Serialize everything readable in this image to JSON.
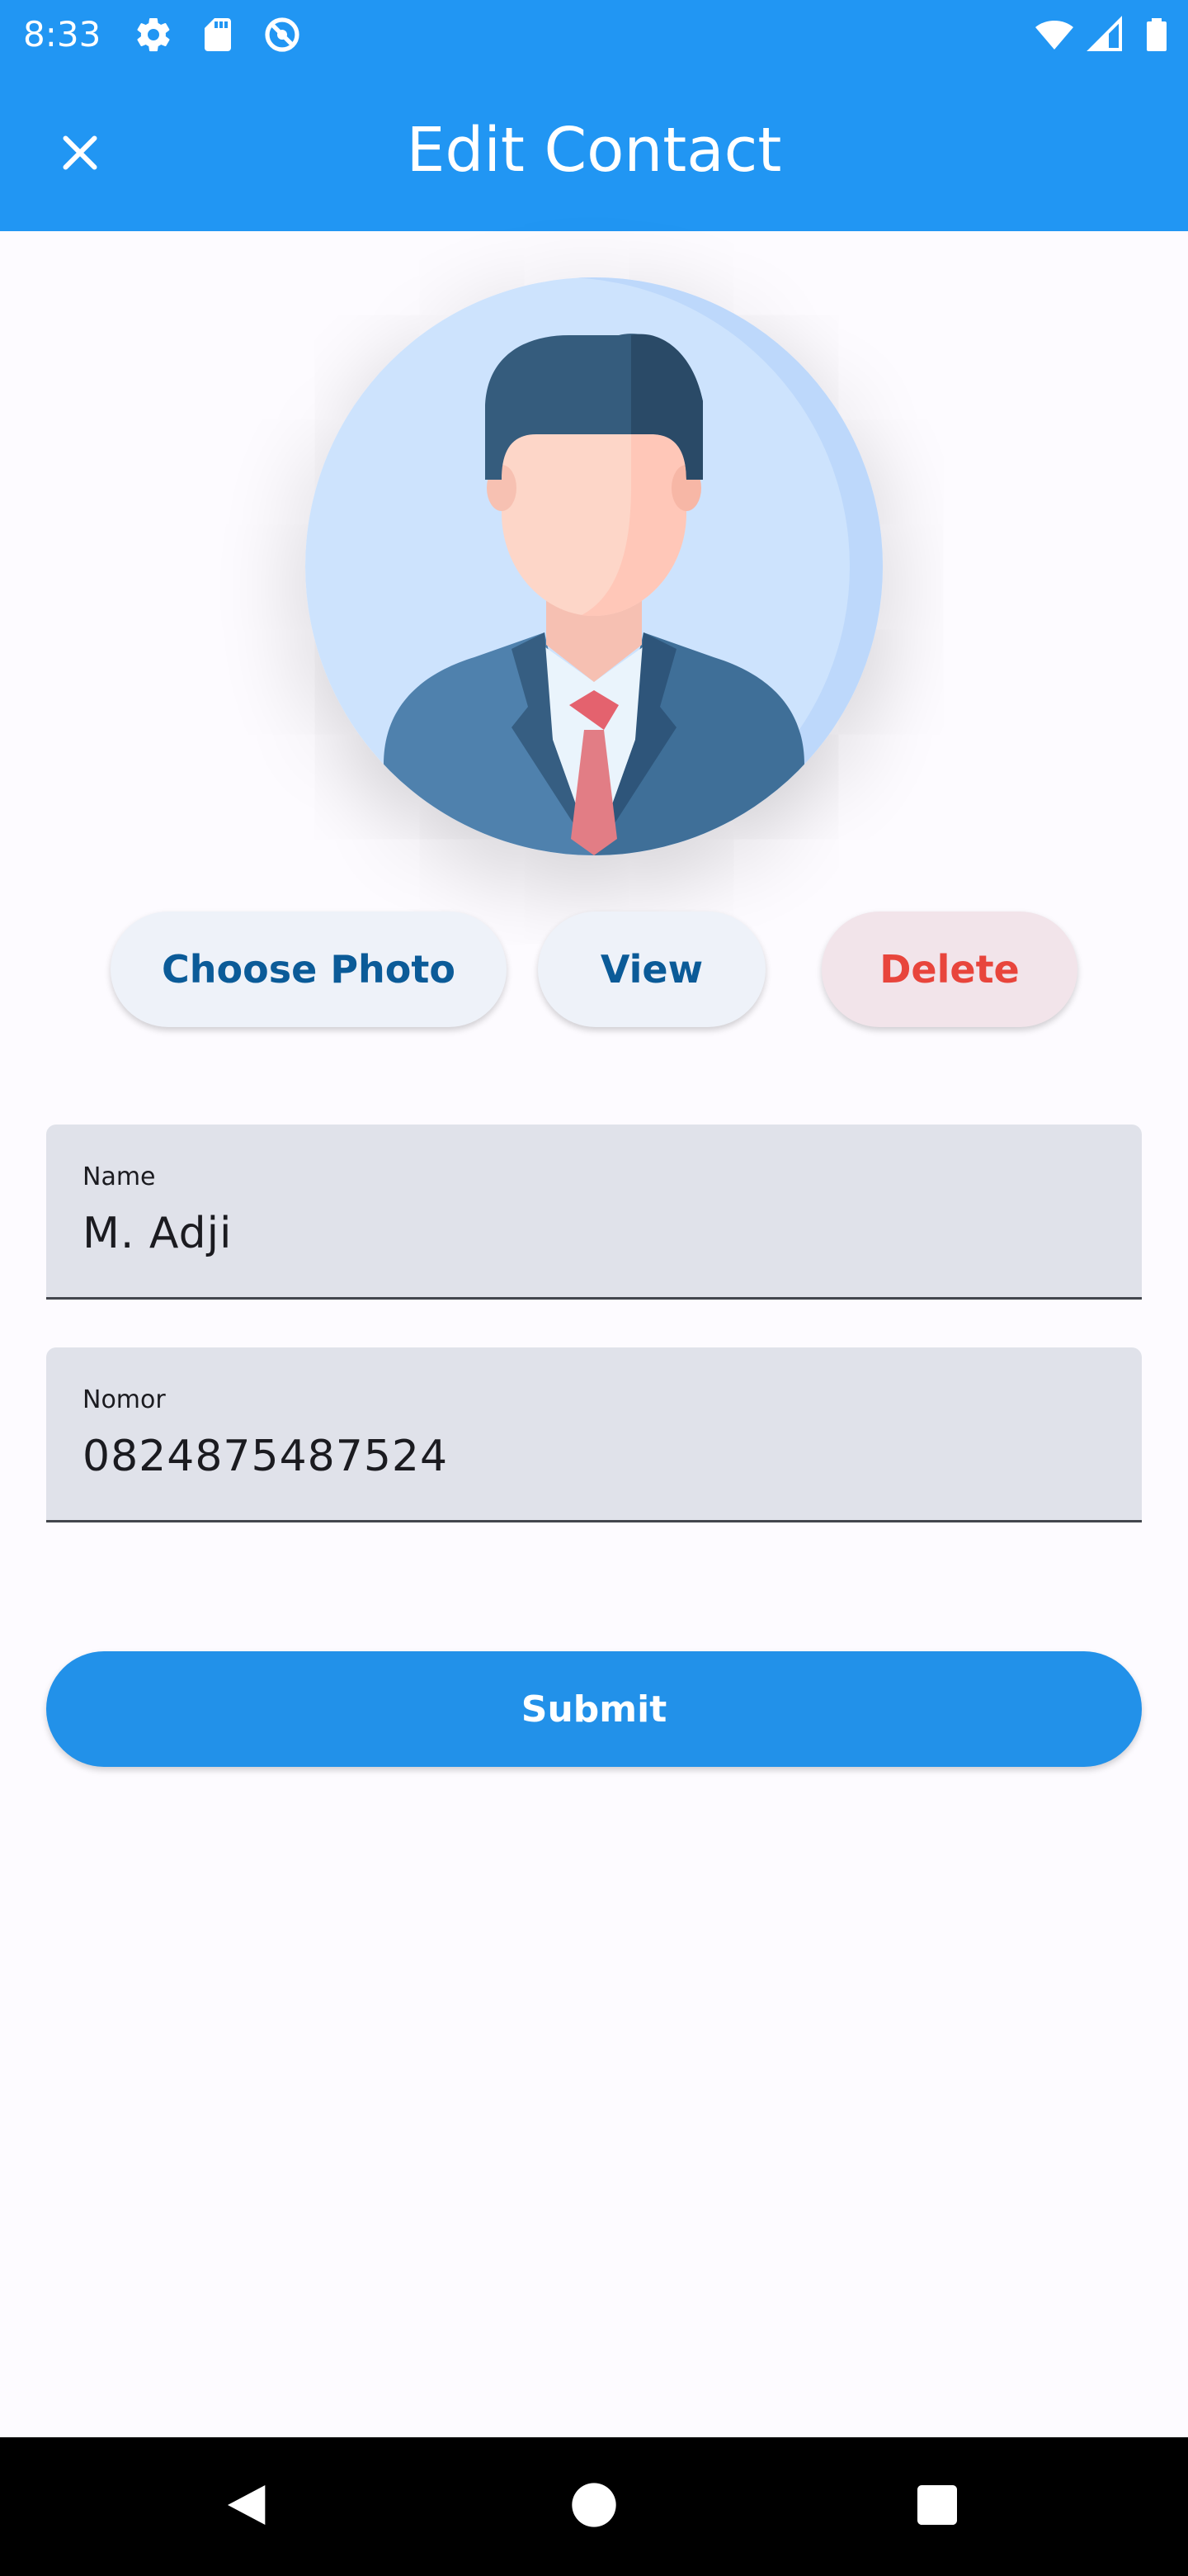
{
  "status_bar": {
    "time": "8:33",
    "left_icons": [
      "settings-icon",
      "sd-card-icon",
      "do-not-disturb-icon"
    ],
    "right_icons": [
      "wifi-icon",
      "cell-signal-icon",
      "battery-icon"
    ]
  },
  "app_bar": {
    "title": "Edit Contact",
    "close_icon": "close-icon"
  },
  "avatar": {
    "icon": "businessman-avatar-icon"
  },
  "actions": {
    "choose_photo_label": "Choose Photo",
    "view_label": "View",
    "delete_label": "Delete"
  },
  "form": {
    "name": {
      "label": "Name",
      "value": "M. Adji"
    },
    "nomor": {
      "label": "Nomor",
      "value": "0824875487524"
    }
  },
  "submit_label": "Submit",
  "nav_bar": {
    "icons": [
      "back-icon",
      "home-icon",
      "recents-icon"
    ]
  },
  "colors": {
    "primary": "#2196f3",
    "primary_text_button": "#0b5b98",
    "danger_text": "#e8453c",
    "field_fill": "#e0e2ea",
    "background": "#fdfbff"
  }
}
